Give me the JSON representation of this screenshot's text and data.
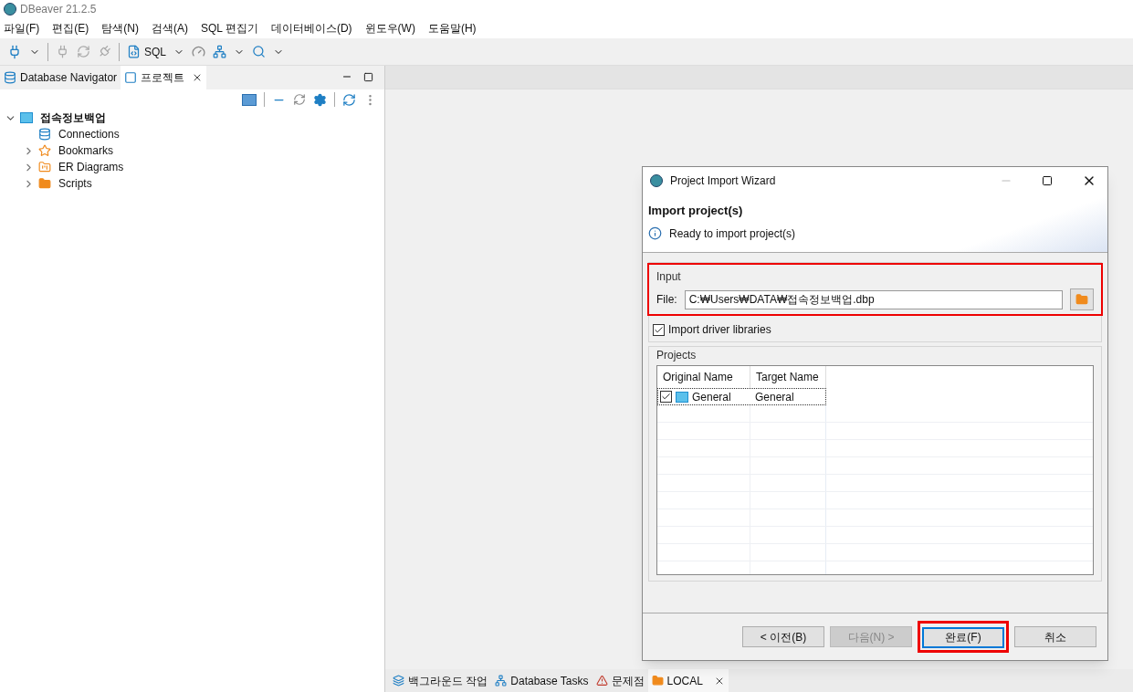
{
  "window": {
    "title": "DBeaver 21.2.5"
  },
  "menu": [
    "파일(F)",
    "편집(E)",
    "탐색(N)",
    "검색(A)",
    "SQL 편집기",
    "데이터베이스(D)",
    "윈도우(W)",
    "도움말(H)"
  ],
  "toolbar": {
    "sql_label": "SQL"
  },
  "left_tabs": [
    {
      "label": "Database Navigator",
      "selected": false
    },
    {
      "label": "프로젝트",
      "selected": true
    }
  ],
  "tree": [
    {
      "label": "접속정보백업",
      "kind": "project",
      "expanded": true,
      "children": [
        {
          "label": "Connections",
          "kind": "connections"
        },
        {
          "label": "Bookmarks",
          "kind": "bookmarks",
          "expanded": false
        },
        {
          "label": "ER Diagrams",
          "kind": "diagrams",
          "expanded": false
        },
        {
          "label": "Scripts",
          "kind": "scripts",
          "expanded": false
        }
      ]
    }
  ],
  "dialog": {
    "title": "Project Import Wizard",
    "heading": "Import project(s)",
    "message": "Ready to import project(s)",
    "input_group": {
      "legend": "Input",
      "file_label": "File:",
      "file_value": "C:₩Users₩DATA₩접속정보백업.dbp"
    },
    "driver_checkbox": {
      "label": "Import driver libraries",
      "checked": true
    },
    "projects_group": {
      "legend": "Projects",
      "columns": [
        "Original Name",
        "Target Name"
      ],
      "rows": [
        {
          "checked": true,
          "original": "General",
          "target": "General"
        }
      ]
    },
    "buttons": [
      {
        "label": "< 이전(B)",
        "disabled": false,
        "default": false
      },
      {
        "label": "다음(N) >",
        "disabled": true,
        "default": false
      },
      {
        "label": "완료(F)",
        "disabled": false,
        "default": true
      },
      {
        "label": "취소",
        "disabled": false,
        "default": false
      }
    ]
  },
  "bottom_tabs": [
    {
      "label": "백그라운드 작업",
      "kind": "background",
      "selected": false
    },
    {
      "label": "Database Tasks",
      "kind": "tasks",
      "selected": false
    },
    {
      "label": "문제점",
      "kind": "problems",
      "selected": false
    },
    {
      "label": "LOCAL",
      "kind": "local",
      "selected": true
    }
  ]
}
